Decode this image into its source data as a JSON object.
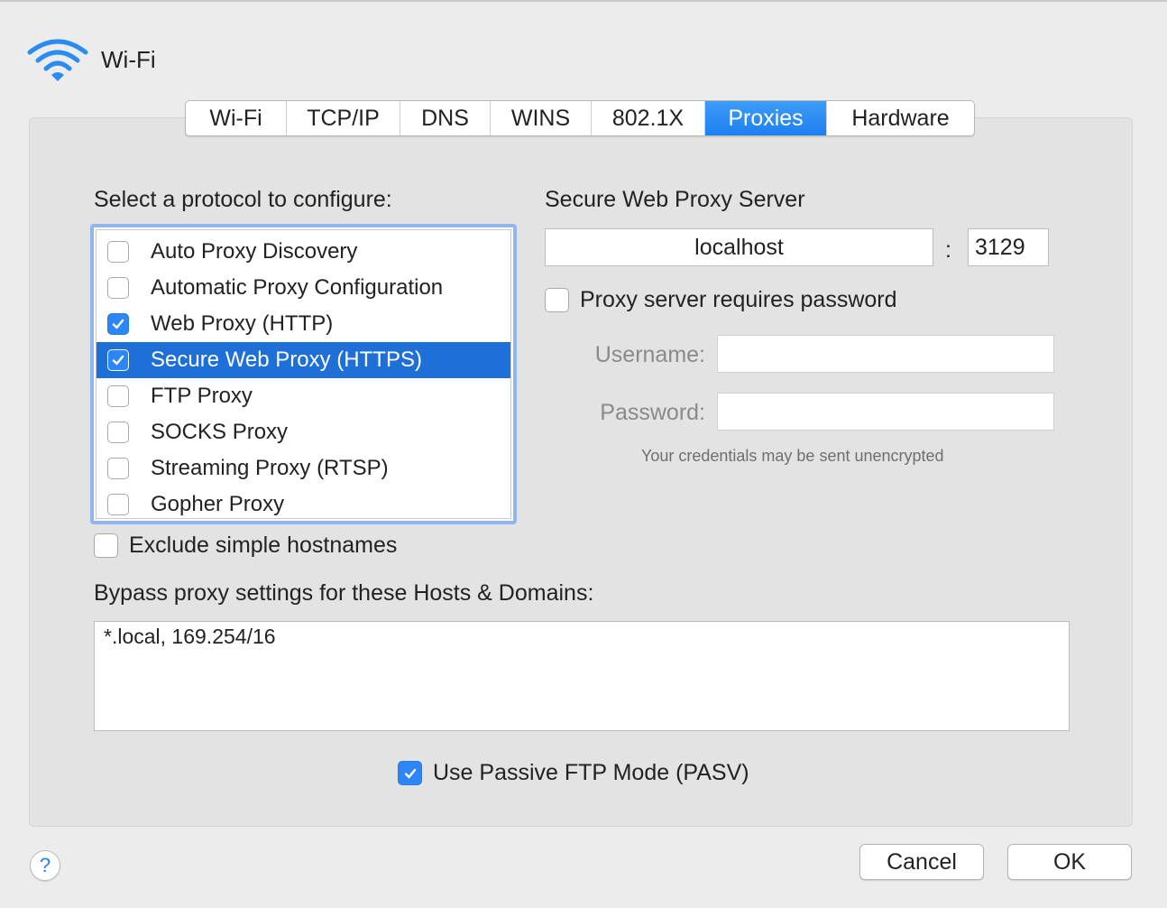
{
  "window": {
    "title": "Wi-Fi",
    "icon": "wifi-icon"
  },
  "tabs": [
    {
      "label": "Wi-Fi",
      "active": false
    },
    {
      "label": "TCP/IP",
      "active": false
    },
    {
      "label": "DNS",
      "active": false
    },
    {
      "label": "WINS",
      "active": false
    },
    {
      "label": "802.1X",
      "active": false
    },
    {
      "label": "Proxies",
      "active": true
    },
    {
      "label": "Hardware",
      "active": false
    }
  ],
  "protocols": {
    "heading": "Select a protocol to configure:",
    "items": [
      {
        "label": "Auto Proxy Discovery",
        "checked": false,
        "selected": false
      },
      {
        "label": "Automatic Proxy Configuration",
        "checked": false,
        "selected": false
      },
      {
        "label": "Web Proxy (HTTP)",
        "checked": true,
        "selected": false
      },
      {
        "label": "Secure Web Proxy (HTTPS)",
        "checked": true,
        "selected": true
      },
      {
        "label": "FTP Proxy",
        "checked": false,
        "selected": false
      },
      {
        "label": "SOCKS Proxy",
        "checked": false,
        "selected": false
      },
      {
        "label": "Streaming Proxy (RTSP)",
        "checked": false,
        "selected": false
      },
      {
        "label": "Gopher Proxy",
        "checked": false,
        "selected": false
      }
    ]
  },
  "server": {
    "heading": "Secure Web Proxy Server",
    "host": "localhost",
    "separator": ":",
    "port": "3129",
    "requires_password_label": "Proxy server requires password",
    "requires_password": false,
    "username_label": "Username:",
    "username": "",
    "password_label": "Password:",
    "password": "",
    "note": "Your credentials may be sent unencrypted"
  },
  "exclude_simple_hostnames": {
    "label": "Exclude simple hostnames",
    "checked": false
  },
  "bypass": {
    "label": "Bypass proxy settings for these Hosts & Domains:",
    "value": "*.local, 169.254/16"
  },
  "passive_ftp": {
    "label": "Use Passive FTP Mode (PASV)",
    "checked": true
  },
  "buttons": {
    "help": "?",
    "cancel": "Cancel",
    "ok": "OK"
  },
  "colors": {
    "accent": "#1f6fd8",
    "checkbox": "#2c86f5",
    "focus_ring": "#8db7ee"
  }
}
